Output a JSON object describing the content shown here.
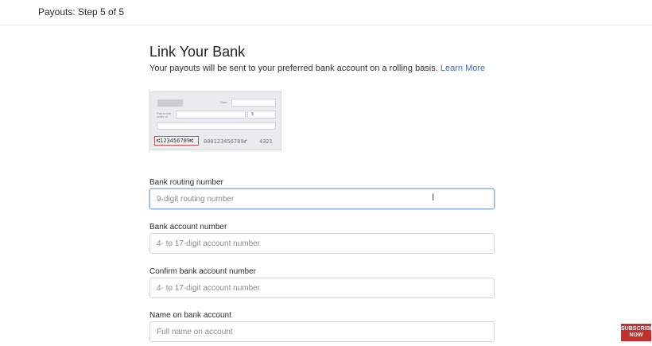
{
  "header": {
    "step_label": "Payouts: Step 5 of 5"
  },
  "main": {
    "title": "Link Your Bank",
    "subtitle": "Your payouts will be sent to your preferred bank account on a rolling basis.",
    "learn_more": "Learn More"
  },
  "check_image": {
    "date_label": "Date",
    "pay_to_label": "Pay to the\norder of",
    "dollar_sign": "$",
    "routing": "⑆123456789⑆",
    "account": "000123456789⑈",
    "check_number": "4321"
  },
  "form": {
    "routing": {
      "label": "Bank routing number",
      "placeholder": "9-digit routing number"
    },
    "account": {
      "label": "Bank account number",
      "placeholder": "4- to 17-digit account number"
    },
    "confirm": {
      "label": "Confirm bank account number",
      "placeholder": "4- to 17-digit account number"
    },
    "name": {
      "label": "Name on bank account",
      "placeholder": "Full name on account"
    }
  },
  "overlay": {
    "subscribe": "SUBSCRIBE NOW"
  },
  "colors": {
    "link": "#3a6fc4",
    "focus_border": "#8fb4e6",
    "routing_highlight": "#d84a4a",
    "subscribe_bg": "#c4302b"
  }
}
